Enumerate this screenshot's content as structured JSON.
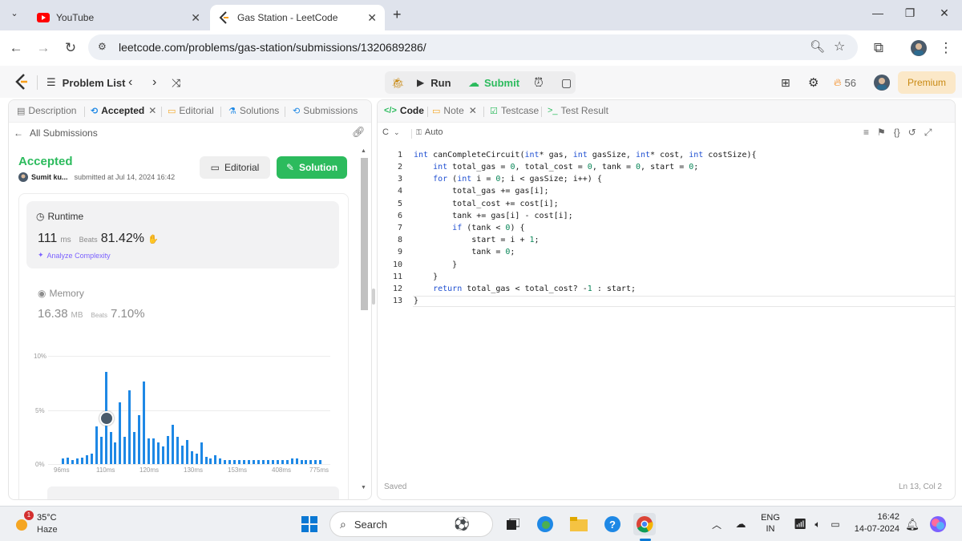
{
  "browser": {
    "tabs": [
      {
        "title": "YouTube",
        "close": "✕"
      },
      {
        "title": "Gas Station - LeetCode",
        "close": "✕"
      }
    ],
    "new_tab": "+",
    "url": "leetcode.com/problems/gas-station/submissions/1320689286/"
  },
  "header": {
    "problem_list": "Problem List",
    "run": "Run",
    "submit": "Submit",
    "streak": "56",
    "premium": "Premium"
  },
  "left_panel": {
    "tabs": [
      "Description",
      "Accepted",
      "Editorial",
      "Solutions",
      "Submissions"
    ],
    "accepted_close": "✕",
    "all_submissions": "All Submissions",
    "status": "Accepted",
    "user": "Sumit ku...",
    "submitted": "submitted at Jul 14, 2024 16:42",
    "editorial_btn": "Editorial",
    "solution_btn": "Solution",
    "runtime": {
      "label": "Runtime",
      "value": "111",
      "unit": "ms",
      "beats_label": "Beats",
      "beats": "81.42%",
      "analyze": "Analyze Complexity"
    },
    "memory": {
      "label": "Memory",
      "value": "16.38",
      "unit": "MB",
      "beats_label": "Beats",
      "beats": "7.10%"
    }
  },
  "chart_data": {
    "type": "bar",
    "ylim": [
      0,
      10
    ],
    "yticks": [
      "10%",
      "5%",
      "0%"
    ],
    "xticks": [
      "96ms",
      "110ms",
      "120ms",
      "130ms",
      "153ms",
      "408ms",
      "775ms"
    ],
    "values": [
      0.5,
      0.6,
      0.4,
      0.5,
      0.6,
      0.8,
      1.0,
      3.5,
      2.5,
      8.5,
      3.0,
      2.0,
      5.7,
      2.5,
      6.8,
      3.0,
      4.5,
      7.6,
      2.4,
      2.4,
      2.0,
      1.6,
      2.6,
      3.6,
      2.5,
      1.7,
      2.2,
      1.2,
      1.0,
      2.0,
      0.7,
      0.5,
      0.8,
      0.5,
      0.4,
      0.4,
      0.4,
      0.4,
      0.4,
      0.4,
      0.4,
      0.4,
      0.4,
      0.4,
      0.4,
      0.4,
      0.4,
      0.4,
      0.5,
      0.5,
      0.4,
      0.4,
      0.4,
      0.4,
      0.4
    ],
    "highlight_index": 9,
    "bar_color": "#1e88e5"
  },
  "right_panel": {
    "tabs": [
      "Code",
      "Note",
      "Testcase",
      "Test Result"
    ],
    "note_close": "✕",
    "lang": "C",
    "mode": "Auto",
    "saved": "Saved",
    "cursor": "Ln 13, Col 2"
  },
  "code": {
    "line_numbers": [
      "1",
      "2",
      "3",
      "4",
      "5",
      "6",
      "7",
      "8",
      "9",
      "10",
      "11",
      "12",
      "13"
    ]
  },
  "taskbar": {
    "temp": "35°C",
    "weather": "Haze",
    "weather_badge": "1",
    "search": "Search",
    "lang1": "ENG",
    "lang2": "IN",
    "time": "16:42",
    "date": "14-07-2024"
  }
}
